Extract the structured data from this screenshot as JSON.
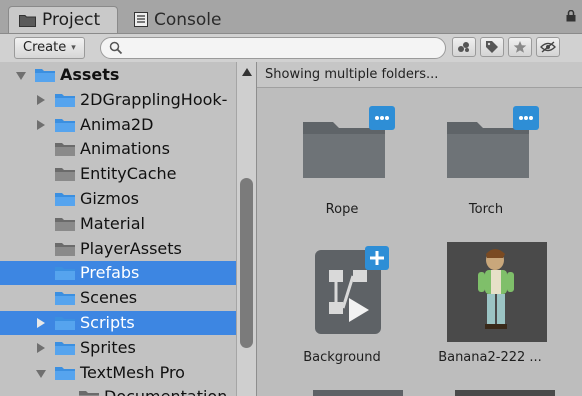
{
  "tabs": {
    "project_label": "Project",
    "console_label": "Console"
  },
  "toolbar": {
    "create_label": "Create",
    "search_placeholder": "",
    "search_value": ""
  },
  "tree": {
    "items": [
      {
        "label": "Assets",
        "depth": 0,
        "expander": "down",
        "selected": false,
        "bold": true
      },
      {
        "label": "2DGrapplingHook-",
        "depth": 1,
        "expander": "right",
        "selected": false
      },
      {
        "label": "Anima2D",
        "depth": 1,
        "expander": "right",
        "selected": false
      },
      {
        "label": "Animations",
        "depth": 1,
        "expander": "none",
        "selected": false
      },
      {
        "label": "EntityCache",
        "depth": 1,
        "expander": "none",
        "selected": false
      },
      {
        "label": "Gizmos",
        "depth": 1,
        "expander": "none",
        "selected": false
      },
      {
        "label": "Material",
        "depth": 1,
        "expander": "none",
        "selected": false
      },
      {
        "label": "PlayerAssets",
        "depth": 1,
        "expander": "none",
        "selected": false
      },
      {
        "label": "Prefabs",
        "depth": 1,
        "expander": "none",
        "selected": true
      },
      {
        "label": "Scenes",
        "depth": 1,
        "expander": "none",
        "selected": false
      },
      {
        "label": "Scripts",
        "depth": 1,
        "expander": "right",
        "selected": true
      },
      {
        "label": "Sprites",
        "depth": 1,
        "expander": "right",
        "selected": false
      },
      {
        "label": "TextMesh Pro",
        "depth": 1,
        "expander": "down",
        "selected": false
      },
      {
        "label": "Documentation",
        "depth": 2,
        "expander": "none",
        "selected": false
      }
    ]
  },
  "content": {
    "header": "Showing multiple folders...",
    "assets": [
      {
        "label": "Rope",
        "kind": "folder",
        "badge": "···"
      },
      {
        "label": "Torch",
        "kind": "folder",
        "badge": "···"
      },
      {
        "label": "Background",
        "kind": "prefab",
        "badge": "+"
      },
      {
        "label": "Banana2-222 ...",
        "kind": "sprite",
        "badge": ""
      }
    ]
  },
  "colors": {
    "selection": "#3d86e2",
    "folder_blue": "#3b8fe0",
    "badge_blue": "#2e8ed6",
    "background": "#c2c2c2"
  },
  "icons": [
    "folder-icon",
    "console-icon",
    "lock-icon",
    "search-icon",
    "label-icon",
    "tag-icon",
    "star-icon",
    "eye-hidden-icon",
    "expand-arrow-icon",
    "collapse-arrow-icon",
    "scroll-up-icon"
  ]
}
